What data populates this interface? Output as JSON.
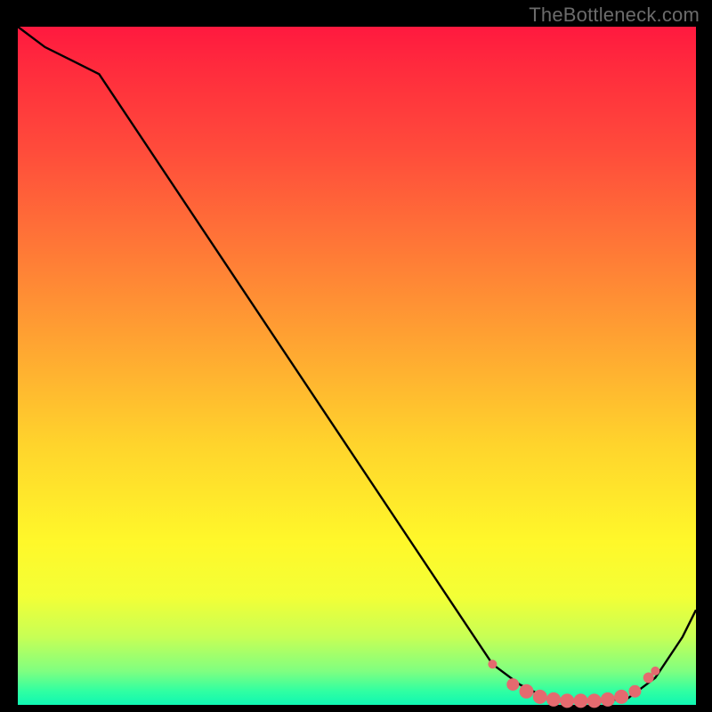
{
  "attribution": "TheBottleneck.com",
  "chart_data": {
    "type": "line",
    "title": "",
    "xlabel": "",
    "ylabel": "",
    "xlim": [
      0,
      100
    ],
    "ylim": [
      0,
      100
    ],
    "series": [
      {
        "name": "curve",
        "x": [
          0,
          4,
          8,
          12,
          70,
          74,
          78,
          82,
          86,
          90,
          94,
          98,
          100
        ],
        "y": [
          100,
          97,
          95,
          93,
          6,
          3,
          1,
          0.5,
          0.5,
          1,
          4,
          10,
          14
        ]
      }
    ],
    "markers": {
      "name": "dots",
      "color": "#e46a6f",
      "x": [
        70,
        73,
        75,
        77,
        79,
        81,
        83,
        85,
        87,
        89,
        91,
        93,
        94
      ],
      "y": [
        6,
        3,
        2,
        1.2,
        0.8,
        0.6,
        0.6,
        0.6,
        0.8,
        1.2,
        2,
        4,
        5
      ],
      "r": [
        5,
        7,
        8,
        8,
        8,
        8,
        8,
        8,
        8,
        8,
        7,
        6,
        5
      ]
    }
  }
}
